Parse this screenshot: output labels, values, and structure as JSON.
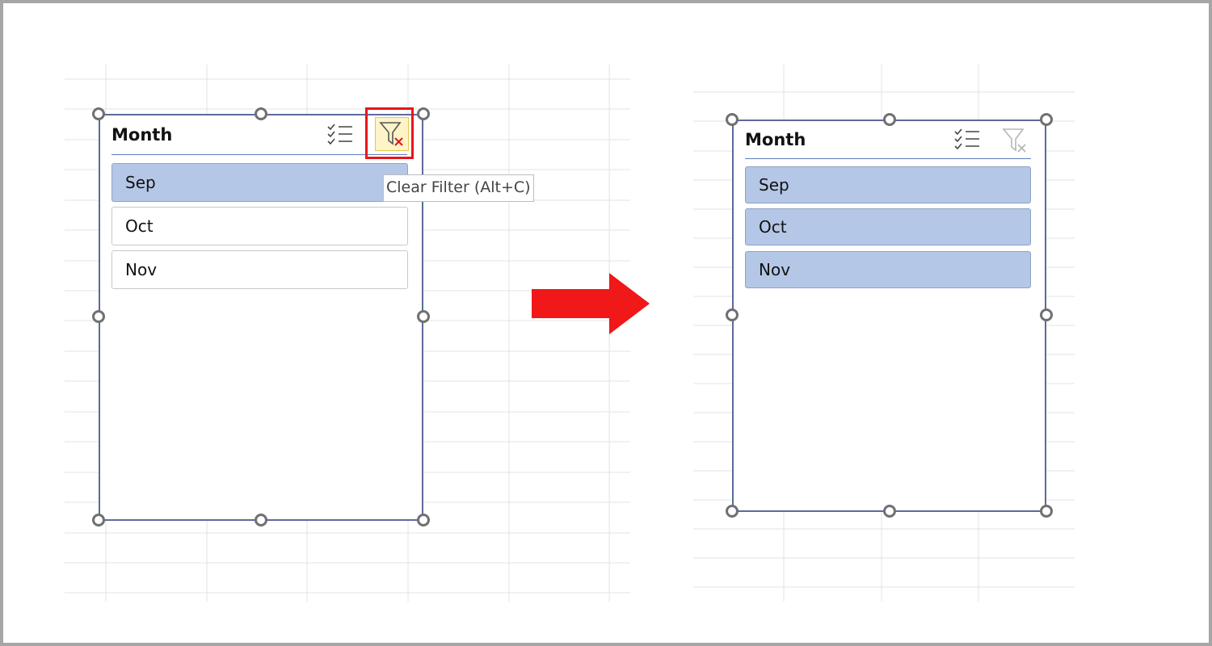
{
  "before": {
    "slicer": {
      "title": "Month",
      "items": [
        {
          "label": "Sep",
          "selected": true
        },
        {
          "label": "Oct",
          "selected": false
        },
        {
          "label": "Nov",
          "selected": false
        }
      ],
      "multiselect_icon": "multi-select-icon",
      "clear_filter_icon": "clear-filter-icon"
    },
    "tooltip": "Clear Filter (Alt+C)"
  },
  "after": {
    "slicer": {
      "title": "Month",
      "items": [
        {
          "label": "Sep",
          "selected": true
        },
        {
          "label": "Oct",
          "selected": true
        },
        {
          "label": "Nov",
          "selected": true
        }
      ],
      "multiselect_icon": "multi-select-icon",
      "clear_filter_icon": "clear-filter-icon-disabled"
    }
  },
  "arrow_icon": "right-arrow-icon",
  "colors": {
    "selected_item": "#b4c7e7",
    "slicer_border": "#5b6b9b",
    "highlight": "#e8151b",
    "arrow": "#f01818",
    "clear_button_bg": "#fff4c8"
  }
}
